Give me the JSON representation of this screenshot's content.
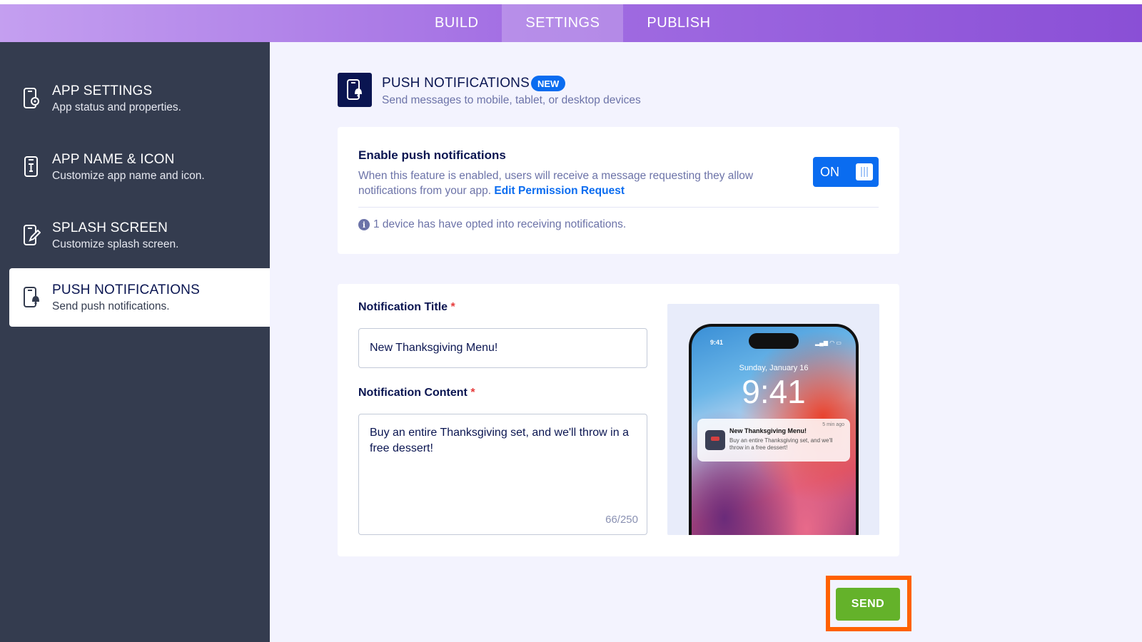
{
  "top_tabs": [
    {
      "label": "BUILD",
      "active": false
    },
    {
      "label": "SETTINGS",
      "active": true
    },
    {
      "label": "PUBLISH",
      "active": false
    }
  ],
  "sidebar": {
    "items": [
      {
        "title": "APP SETTINGS",
        "subtitle": "App status and properties.",
        "icon": "gear-phone-icon"
      },
      {
        "title": "APP NAME & ICON",
        "subtitle": "Customize app name and icon.",
        "icon": "phone-text-icon"
      },
      {
        "title": "SPLASH SCREEN",
        "subtitle": "Customize splash screen.",
        "icon": "phone-edit-icon"
      },
      {
        "title": "PUSH NOTIFICATIONS",
        "subtitle": "Send push notifications.",
        "icon": "phone-bell-icon",
        "active": true
      }
    ]
  },
  "page_header": {
    "title": "PUSH NOTIFICATIONS",
    "badge": "NEW",
    "subtitle": "Send messages to mobile, tablet, or desktop devices"
  },
  "enable_card": {
    "title": "Enable push notifications",
    "description": "When this feature is enabled, users will receive a message requesting they allow notifications from your app.",
    "link": "Edit Permission Request",
    "toggle_label": "ON",
    "info": "1 device has have opted into receiving notifications."
  },
  "form": {
    "title_label": "Notification Title",
    "title_value": "New Thanksgiving Menu!",
    "content_label": "Notification Content",
    "content_value": "Buy an entire Thanksgiving set, and we'll throw in a free dessert!",
    "required_mark": "*",
    "counter": "66/250"
  },
  "preview": {
    "status_time": "9:41",
    "date": "Sunday, January 16",
    "clock": "9:41",
    "notif_title": "New Thanksgiving Menu!",
    "notif_time": "5 min ago",
    "notif_body": "Buy an entire Thanksgiving set, and we'll throw in a free dessert!"
  },
  "send_label": "SEND",
  "colors": {
    "brand_purple": "#a36fe3",
    "sidebar_bg": "#343c4f",
    "primary_blue": "#0a6cf0",
    "send_green": "#64b22a",
    "highlight_orange": "#ff6100",
    "navy_text": "#0a1551"
  }
}
